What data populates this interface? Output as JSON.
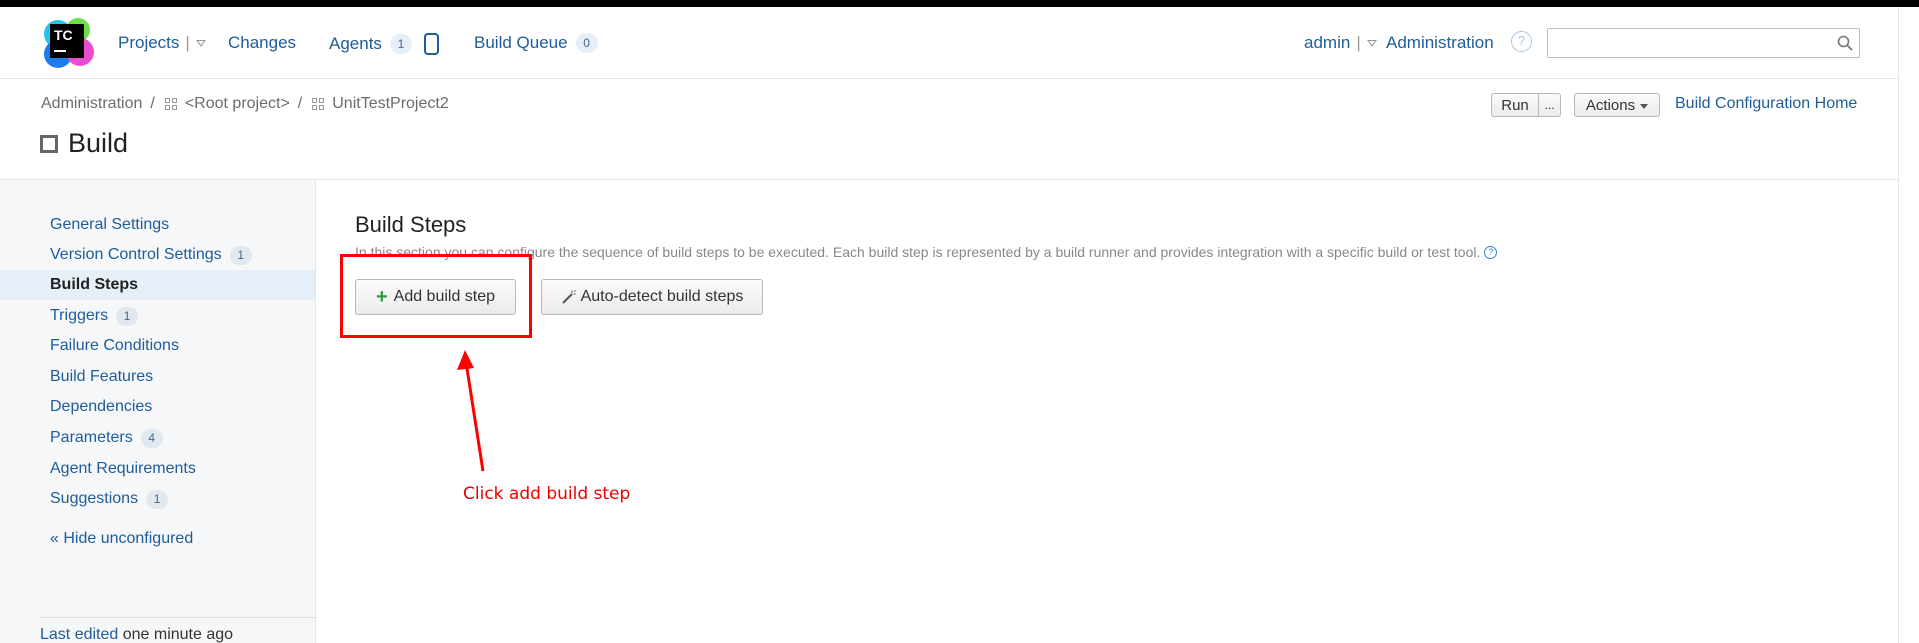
{
  "header": {
    "logo_text": "TC",
    "nav": {
      "projects": "Projects",
      "changes": "Changes",
      "agents": "Agents",
      "agents_count": "1",
      "build_queue": "Build Queue",
      "build_queue_count": "0"
    },
    "user": "admin",
    "administration": "Administration",
    "search": {
      "placeholder": "",
      "value": ""
    }
  },
  "breadcrumb": {
    "items": [
      "Administration",
      "<Root project>",
      "UnitTestProject2"
    ]
  },
  "page_title": "Build",
  "toolbar": {
    "run": "Run",
    "more": "...",
    "actions": "Actions",
    "build_config_home": "Build Configuration Home"
  },
  "sidebar": {
    "items": [
      {
        "label": "General Settings",
        "count": null
      },
      {
        "label": "Version Control Settings",
        "count": "1"
      },
      {
        "label": "Build Steps",
        "count": null,
        "active": true
      },
      {
        "label": "Triggers",
        "count": "1"
      },
      {
        "label": "Failure Conditions",
        "count": null
      },
      {
        "label": "Build Features",
        "count": null
      },
      {
        "label": "Dependencies",
        "count": null
      },
      {
        "label": "Parameters",
        "count": "4"
      },
      {
        "label": "Agent Requirements",
        "count": null
      },
      {
        "label": "Suggestions",
        "count": "1"
      }
    ],
    "hide_unconfigured": "« Hide unconfigured",
    "last_edited_label": "Last edited",
    "last_edited_value": "one minute ago"
  },
  "main": {
    "section_title": "Build Steps",
    "description": "In this section you can configure the sequence of build steps to be executed. Each build step is represented by a build runner and provides integration with a specific build or test tool.",
    "add_build_step": "Add build step",
    "auto_detect": "Auto-detect build steps"
  },
  "annotation": {
    "text": "Click add build step",
    "color": "#ff0000"
  }
}
